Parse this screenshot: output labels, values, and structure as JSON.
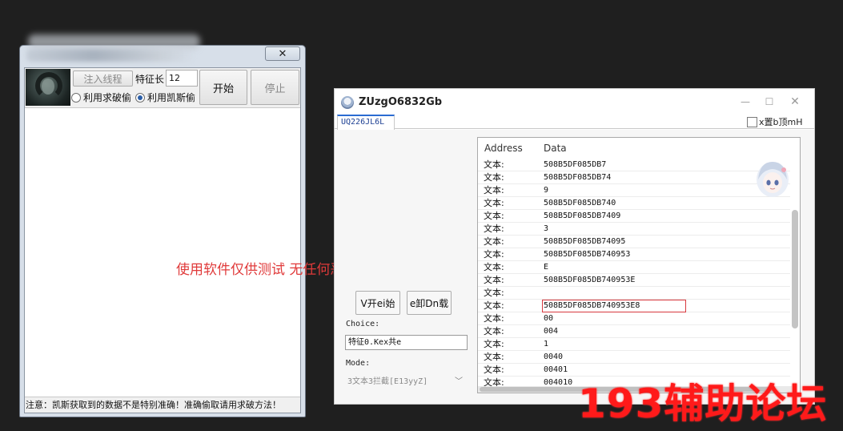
{
  "left_window": {
    "close_glyph": "✕",
    "inject_button": "注入线程",
    "feature_label": "特征长",
    "feature_value": "12",
    "start_button": "开始",
    "stop_button": "停止",
    "radio_crack": "利用求破偷",
    "radio_kais": "利用凯斯偷",
    "radio_selected": "利用凯斯偷",
    "status_text": "注意：凯斯获取到的数据不是特别准确！准确偷取请用求破方法！"
  },
  "overlay_text": "使用软件仅供测试 无任何恶意",
  "right_window": {
    "title": "ZUzgO6832Gb",
    "tab_label": "UQ226JL6L",
    "topmost_checkbox": "x置b顶mH",
    "topmost_checked": false,
    "min_glyph": "—",
    "max_glyph": "☐",
    "close_glyph": "✕",
    "v_start_button": "V开ei始",
    "e_unload_button": "e卸Dn载",
    "choice_label": "Choice:",
    "choice_value": "特征0.Kex共e",
    "mode_label": "Mode:",
    "mode_value": "3文本3拦截[E13yyZ]",
    "list": {
      "col_address": "Address",
      "col_data": "Data",
      "rows": [
        {
          "address": "文本:",
          "data": "508B5DF085DB7"
        },
        {
          "address": "文本:",
          "data": "508B5DF085DB74"
        },
        {
          "address": "文本:",
          "data": "9"
        },
        {
          "address": "文本:",
          "data": "508B5DF085DB740"
        },
        {
          "address": "文本:",
          "data": "508B5DF085DB7409"
        },
        {
          "address": "文本:",
          "data": "3"
        },
        {
          "address": "文本:",
          "data": "508B5DF085DB74095"
        },
        {
          "address": "文本:",
          "data": "508B5DF085DB740953"
        },
        {
          "address": "文本:",
          "data": "E"
        },
        {
          "address": "文本:",
          "data": "508B5DF085DB740953E"
        },
        {
          "address": "文本:",
          "data": ""
        },
        {
          "address": "文本:",
          "data": "508B5DF085DB740953E8"
        },
        {
          "address": "文本:",
          "data": "00"
        },
        {
          "address": "文本:",
          "data": "004"
        },
        {
          "address": "文本:",
          "data": "1"
        },
        {
          "address": "文本:",
          "data": "0040"
        },
        {
          "address": "文本:",
          "data": "00401"
        },
        {
          "address": "文本:",
          "data": "004010"
        }
      ],
      "selected_row": 11
    }
  },
  "watermark": "193辅助论坛",
  "colors": {
    "accent_red": "#e03a3a",
    "tab_accent": "#2b6cd2",
    "selection_outline": "#d8393f"
  }
}
